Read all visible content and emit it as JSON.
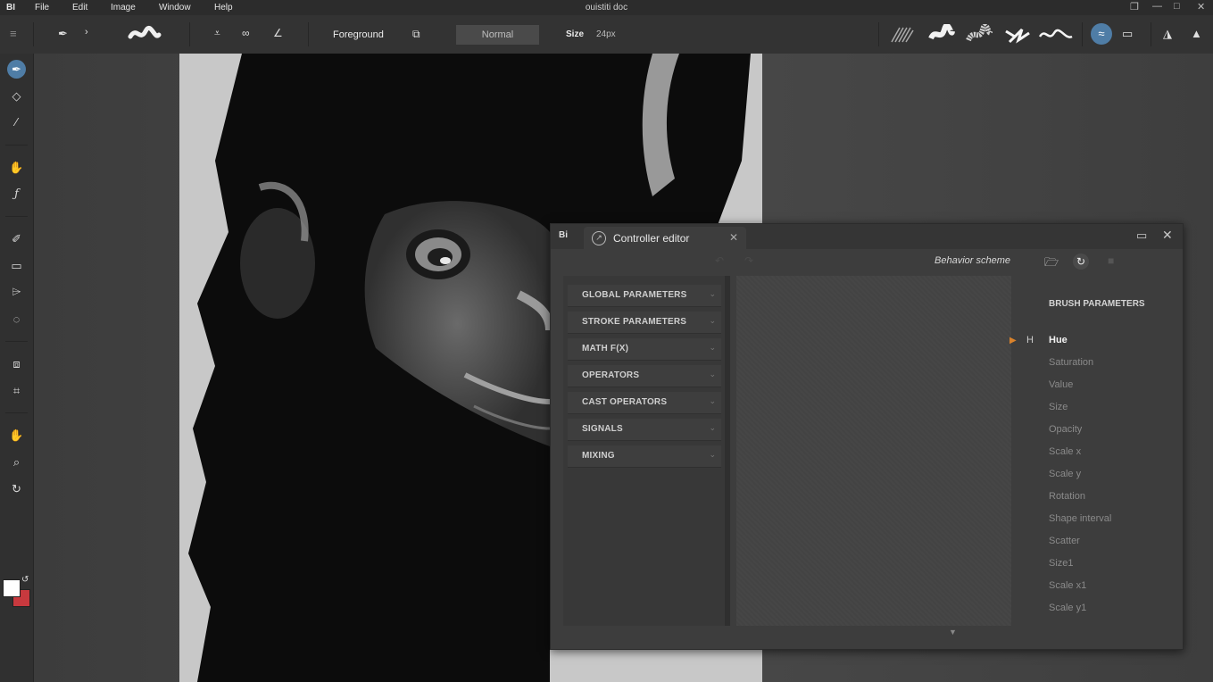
{
  "menubar": {
    "logo": "BI",
    "menus": [
      "File",
      "Edit",
      "Image",
      "Window",
      "Help"
    ],
    "document_title": "ouistiti doc",
    "window_controls": [
      "restore-icon",
      "minimize-icon",
      "maximize-icon",
      "close-icon"
    ]
  },
  "toolbar": {
    "color_source_label": "Foreground",
    "blend_mode": "Normal",
    "size_label": "Size",
    "size_value": "24px",
    "brush_presets_count": 5
  },
  "tools": [
    {
      "name": "brush-icon",
      "active": true
    },
    {
      "name": "eraser-icon"
    },
    {
      "name": "eyedropper-icon"
    },
    {
      "name": "smudge-icon"
    },
    {
      "name": "function-icon"
    },
    {
      "name": "pen-icon"
    },
    {
      "name": "rectangle-select-icon"
    },
    {
      "name": "lasso-icon"
    },
    {
      "name": "ellipse-select-icon"
    },
    {
      "name": "transform-icon"
    },
    {
      "name": "crop-icon"
    },
    {
      "name": "hand-icon"
    },
    {
      "name": "zoom-icon"
    },
    {
      "name": "rotate-view-icon"
    }
  ],
  "colors": {
    "foreground": "#ffffff",
    "background": "#c8393e",
    "accent": "#4f7da6",
    "selection_marker": "#d9822b"
  },
  "editor": {
    "logo": "Bi",
    "tab_title": "Controller editor",
    "behavior_label": "Behavior scheme",
    "categories": [
      "GLOBAL PARAMETERS",
      "STROKE PARAMETERS",
      "MATH F(X)",
      "OPERATORS",
      "CAST OPERATORS",
      "SIGNALS",
      "MIXING"
    ],
    "params_heading": "BRUSH PARAMETERS",
    "param_icon": "H",
    "params": [
      "Hue",
      "Saturation",
      "Value",
      "Size",
      "Opacity",
      "Scale x",
      "Scale y",
      "Rotation",
      "Shape interval",
      "Scatter",
      "Size1",
      "Scale x1",
      "Scale y1"
    ],
    "selected_param": "Hue"
  }
}
